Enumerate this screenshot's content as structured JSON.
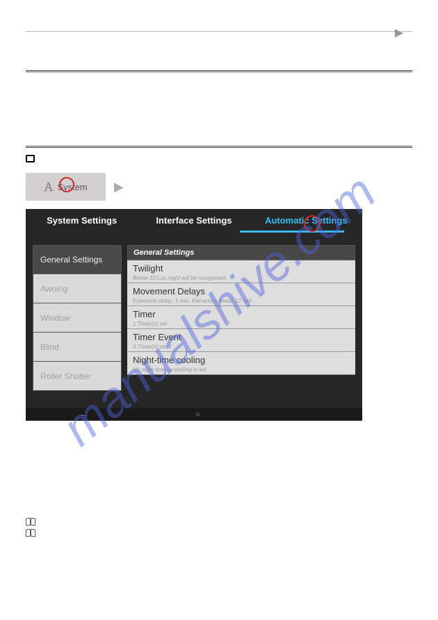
{
  "watermark": "manualshive.com",
  "breadcrumb": {
    "label": "System"
  },
  "tabs": {
    "system": "System Settings",
    "interface": "Interface Settings",
    "automatic": "Automatic Settings"
  },
  "sidebar": {
    "items": [
      {
        "label": "General Settings"
      },
      {
        "label": "Awning"
      },
      {
        "label": "Window"
      },
      {
        "label": "Blind"
      },
      {
        "label": "Roller Shutter"
      }
    ]
  },
  "section": {
    "header": "General Settings",
    "items": [
      {
        "title": "Twilight",
        "sub": "Below 10 Lux night will be recognised"
      },
      {
        "title": "Movement Delays",
        "sub": "Extension delay: 1 min. Retraction delay: 12 min"
      },
      {
        "title": "Timer",
        "sub": "1 Timer(s) set"
      },
      {
        "title": "Timer Event",
        "sub": "0 Timer(s) set"
      },
      {
        "title": "Night-time cooling",
        "sub": "No night-time re-cooling is set"
      }
    ]
  },
  "navbar": {
    "back": "←",
    "home": "○",
    "recent": ""
  }
}
